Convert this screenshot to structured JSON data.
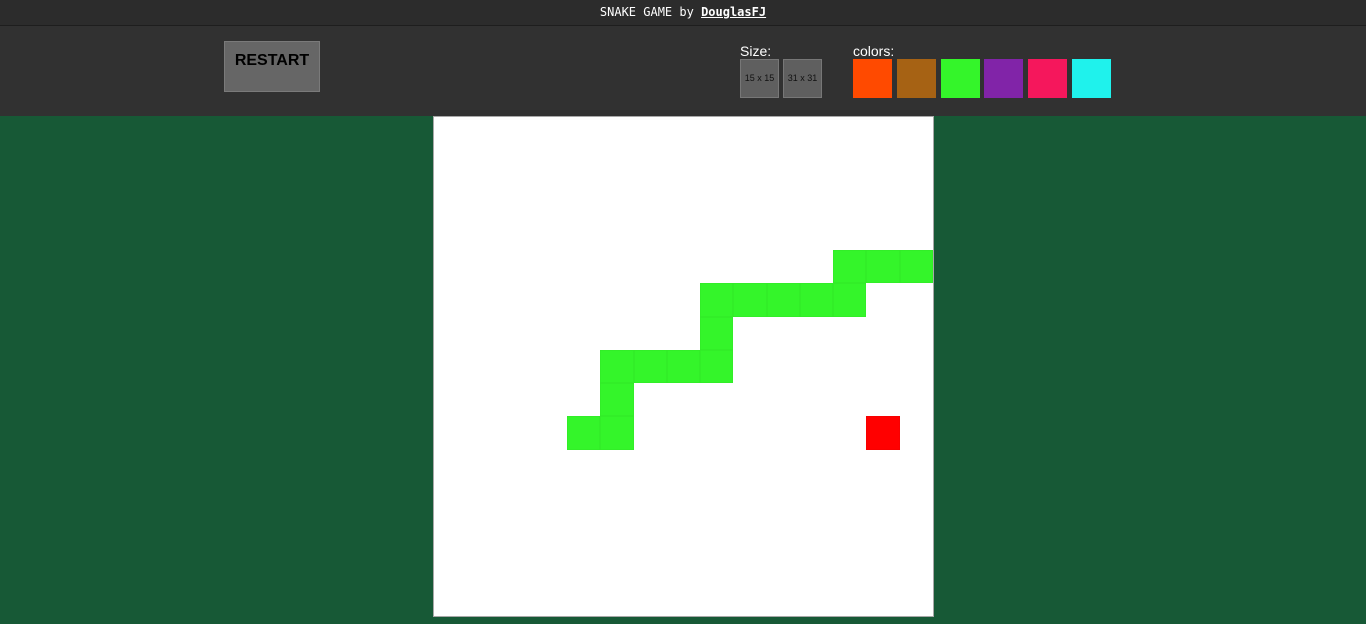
{
  "header": {
    "title": "SNAKE GAME by",
    "author_link": "DouglasFJ"
  },
  "controls": {
    "restart_label": "RESTART",
    "size_label": "Size:",
    "size_options": [
      "15 x 15",
      "31 x 31"
    ],
    "colors_label": "colors:",
    "color_options": [
      "#ff4a00",
      "#a66214",
      "#34f52a",
      "#8124a8",
      "#f5175c",
      "#1ff2ec"
    ]
  },
  "game": {
    "grid_size": 15,
    "snake_color": "#34f52a",
    "food_color": "#ff0000",
    "snake_cells": [
      [
        4,
        9
      ],
      [
        5,
        9
      ],
      [
        5,
        8
      ],
      [
        5,
        7
      ],
      [
        6,
        7
      ],
      [
        7,
        7
      ],
      [
        8,
        7
      ],
      [
        8,
        6
      ],
      [
        8,
        5
      ],
      [
        9,
        5
      ],
      [
        10,
        5
      ],
      [
        11,
        5
      ],
      [
        12,
        5
      ],
      [
        12,
        4
      ],
      [
        13,
        4
      ],
      [
        14,
        4
      ]
    ],
    "food_cell": [
      13,
      9
    ]
  }
}
